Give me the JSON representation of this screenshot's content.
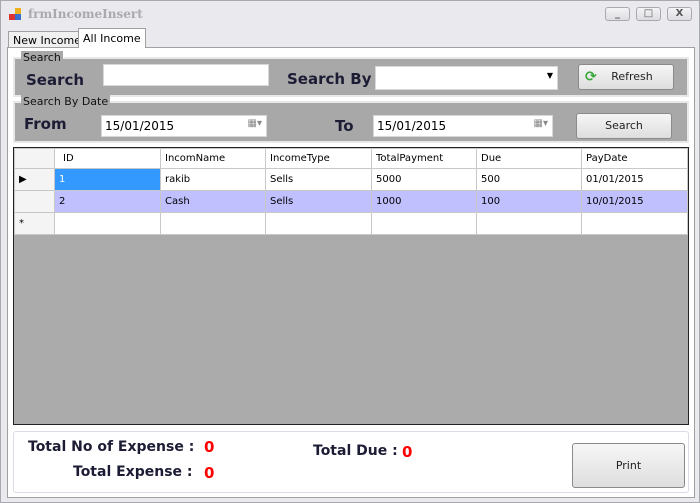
{
  "window": {
    "title": "frmIncomeInsert",
    "minimize": "_",
    "maximize": "□",
    "close": "X"
  },
  "tabs": [
    {
      "label": "New Income"
    },
    {
      "label": "All Income"
    }
  ],
  "search_group": {
    "legend": "Search",
    "search_label": "Search",
    "search_value": "",
    "search_by_label": "Search By",
    "search_by_value": "",
    "refresh_label": "Refresh"
  },
  "date_group": {
    "legend": "Search By Date",
    "from_label": "From",
    "from_value": "15/01/2015",
    "to_label": "To",
    "to_value": "15/01/2015",
    "search_label": "Search"
  },
  "grid": {
    "columns": [
      "ID",
      "IncomName",
      "IncomeType",
      "TotalPayment",
      "Due",
      "PayDate"
    ],
    "rows": [
      [
        "1",
        "rakib",
        "Sells",
        "5000",
        "500",
        "01/01/2015"
      ],
      [
        "2",
        "Cash",
        "Sells",
        "1000",
        "100",
        "10/01/2015"
      ]
    ],
    "new_row_marker": "*"
  },
  "summary": {
    "total_no_label": "Total No of Expense :",
    "total_no_value": "0",
    "total_expense_label": "Total Expense :",
    "total_expense_value": "0",
    "total_due_label": "Total Due :",
    "total_due_value": "0",
    "print_label": "Print"
  }
}
